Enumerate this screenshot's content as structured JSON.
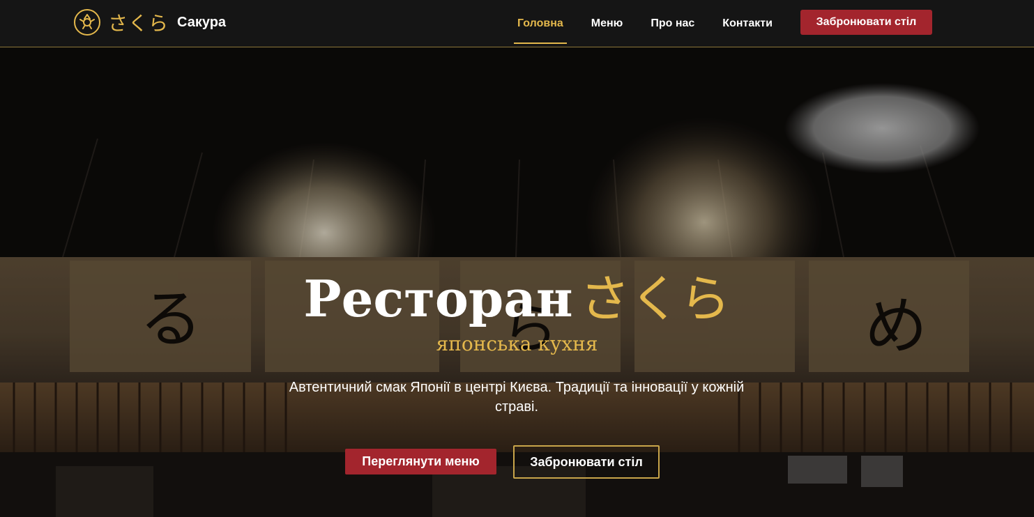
{
  "brand": {
    "logo_icon": "sakura-flower-icon",
    "jp_name": "さくら",
    "name": "Сакура"
  },
  "nav": {
    "items": [
      {
        "label": "Головна",
        "active": true
      },
      {
        "label": "Меню",
        "active": false
      },
      {
        "label": "Про нас",
        "active": false
      },
      {
        "label": "Контакти",
        "active": false
      }
    ],
    "cta_label": "Забронювати стіл"
  },
  "hero": {
    "title": "Ресторан",
    "title_jp": "さくら",
    "subtitle": "японська кухня",
    "description": "Автентичний смак Японії в центрі Києва. Традиції та інновації у кожній страві.",
    "primary_button": "Переглянути меню",
    "secondary_button": "Забронювати стіл",
    "background_kana": [
      "る",
      "ら",
      "め"
    ]
  },
  "colors": {
    "accent_gold": "#e4b84c",
    "accent_red": "#a3252d",
    "nav_bg": "#151515"
  }
}
